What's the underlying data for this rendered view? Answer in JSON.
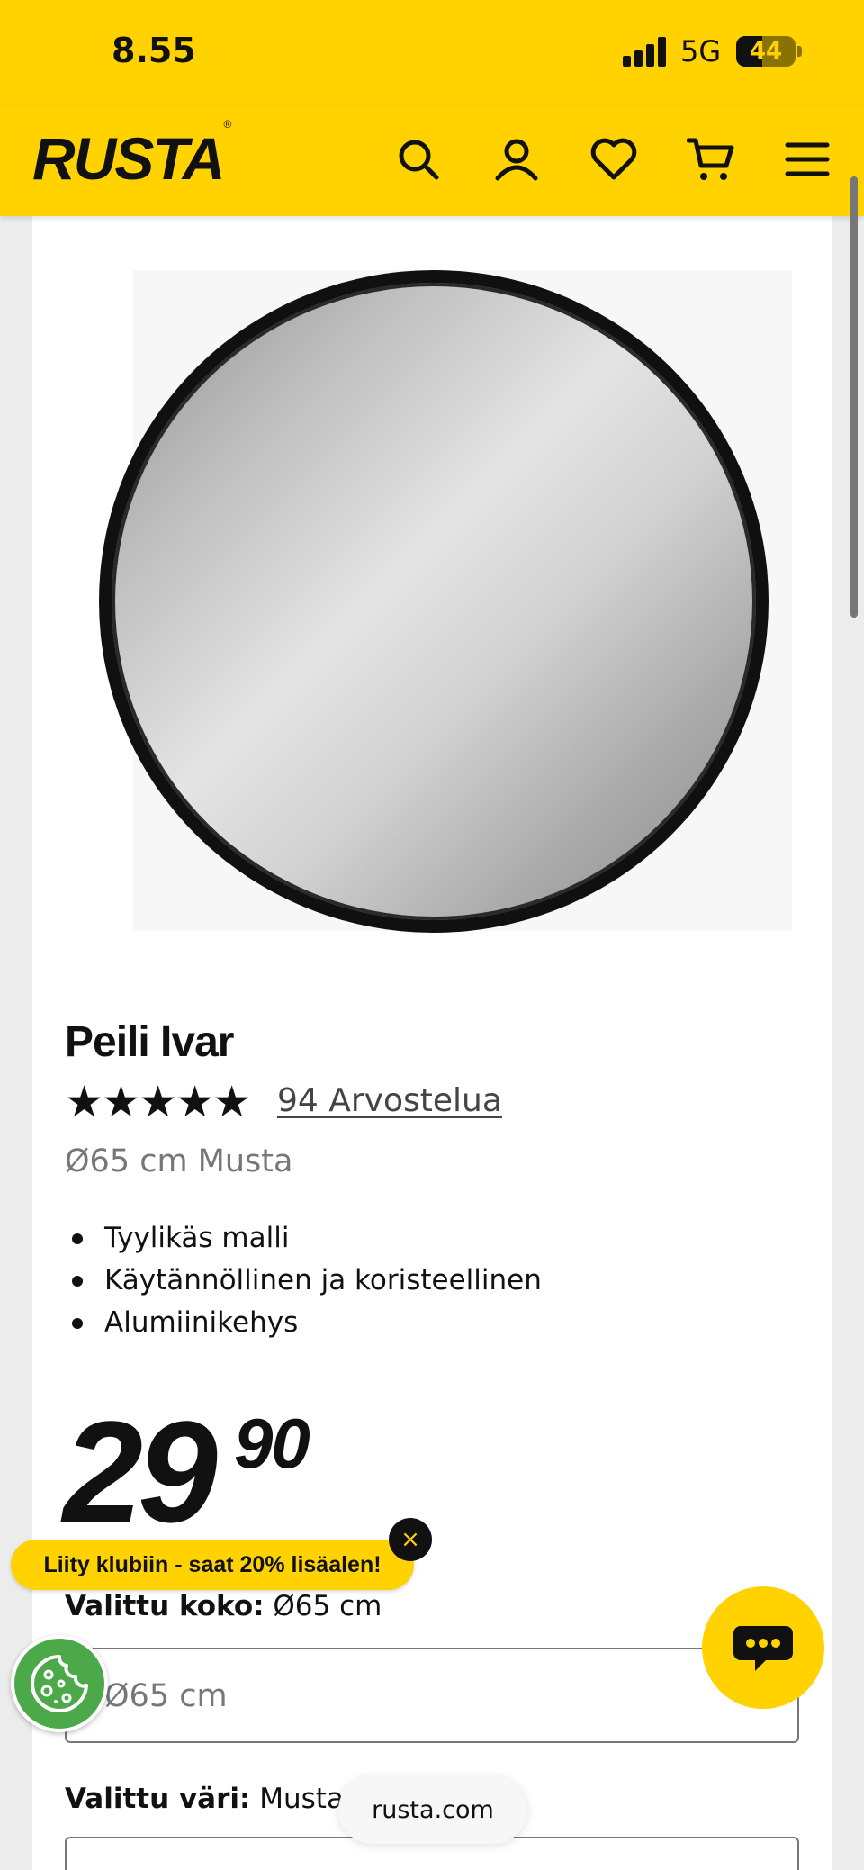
{
  "status_bar": {
    "time": "8.55",
    "network": "5G",
    "battery": "44",
    "battery_level": 0.44
  },
  "header": {
    "logo": "RUSTA",
    "logo_mark": "®",
    "icons": [
      "search-icon",
      "account-icon",
      "favorites-icon",
      "cart-icon",
      "menu-icon"
    ]
  },
  "product": {
    "title": "Peili Ivar",
    "stars": "★★★★★",
    "rating": 5,
    "reviews_link": "94 Arvostelua",
    "variant": "Ø65 cm Musta",
    "features": [
      "Tyylikäs malli",
      "Käytännöllinen ja koristeellinen",
      "Alumiinikehys"
    ],
    "price_main": "29",
    "price_decimals": "90"
  },
  "club_banner": {
    "text": "Liity klubiin - saat 20% lisäalen!",
    "close": "×"
  },
  "options": {
    "size_label": "Valittu koko:",
    "size_value": "Ø65 cm",
    "size_select_value": "Ø65 cm",
    "color_label": "Valittu väri:",
    "color_value": "Musta"
  },
  "browser": {
    "url": "rusta.com"
  },
  "colors": {
    "brand_yellow": "#ffd200",
    "cookie_green": "#4ca94a"
  }
}
